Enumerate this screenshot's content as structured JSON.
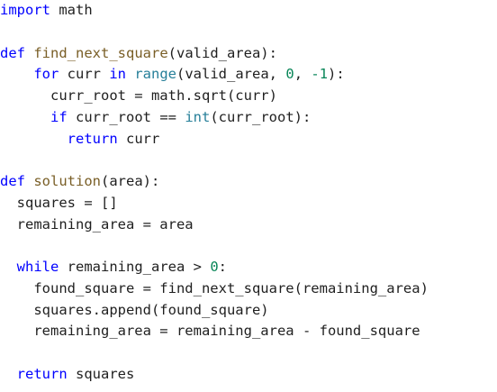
{
  "editor": {
    "language": "python",
    "colors": {
      "background": "#ffffff",
      "keyword": "#0000ff",
      "function_name": "#795e26",
      "number": "#098658",
      "builtin": "#267f99",
      "text": "#1f1f1f"
    },
    "lines": [
      [
        {
          "t": "import",
          "c": "kw"
        },
        {
          "t": " math",
          "c": "id"
        }
      ],
      [],
      [
        {
          "t": "def",
          "c": "kw"
        },
        {
          "t": " ",
          "c": "id"
        },
        {
          "t": "find_next_square",
          "c": "fn"
        },
        {
          "t": "(valid_area):",
          "c": "id"
        }
      ],
      [
        {
          "t": "    ",
          "c": "id"
        },
        {
          "t": "for",
          "c": "kw"
        },
        {
          "t": " curr ",
          "c": "id"
        },
        {
          "t": "in",
          "c": "kw"
        },
        {
          "t": " ",
          "c": "id"
        },
        {
          "t": "range",
          "c": "builtin"
        },
        {
          "t": "(valid_area, ",
          "c": "id"
        },
        {
          "t": "0",
          "c": "num"
        },
        {
          "t": ", ",
          "c": "id"
        },
        {
          "t": "-1",
          "c": "num"
        },
        {
          "t": "):",
          "c": "id"
        }
      ],
      [
        {
          "t": "      curr_root = math.sqrt(curr)",
          "c": "id"
        }
      ],
      [
        {
          "t": "      ",
          "c": "id"
        },
        {
          "t": "if",
          "c": "kw"
        },
        {
          "t": " curr_root == ",
          "c": "id"
        },
        {
          "t": "int",
          "c": "builtin"
        },
        {
          "t": "(curr_root):",
          "c": "id"
        }
      ],
      [
        {
          "t": "        ",
          "c": "id"
        },
        {
          "t": "return",
          "c": "kw"
        },
        {
          "t": " curr",
          "c": "id"
        }
      ],
      [],
      [
        {
          "t": "def",
          "c": "kw"
        },
        {
          "t": " ",
          "c": "id"
        },
        {
          "t": "solution",
          "c": "fn"
        },
        {
          "t": "(area):",
          "c": "id"
        }
      ],
      [
        {
          "t": "  squares = []",
          "c": "id"
        }
      ],
      [
        {
          "t": "  remaining_area = area",
          "c": "id"
        }
      ],
      [],
      [
        {
          "t": "  ",
          "c": "id"
        },
        {
          "t": "while",
          "c": "kw"
        },
        {
          "t": " remaining_area > ",
          "c": "id"
        },
        {
          "t": "0",
          "c": "num"
        },
        {
          "t": ":",
          "c": "id"
        }
      ],
      [
        {
          "t": "    found_square = find_next_square(remaining_area)",
          "c": "id"
        }
      ],
      [
        {
          "t": "    squares.append(found_square)",
          "c": "id"
        }
      ],
      [
        {
          "t": "    remaining_area = remaining_area - found_square",
          "c": "id"
        }
      ],
      [],
      [
        {
          "t": "  ",
          "c": "id"
        },
        {
          "t": "return",
          "c": "kw"
        },
        {
          "t": " squares",
          "c": "id"
        }
      ]
    ]
  }
}
